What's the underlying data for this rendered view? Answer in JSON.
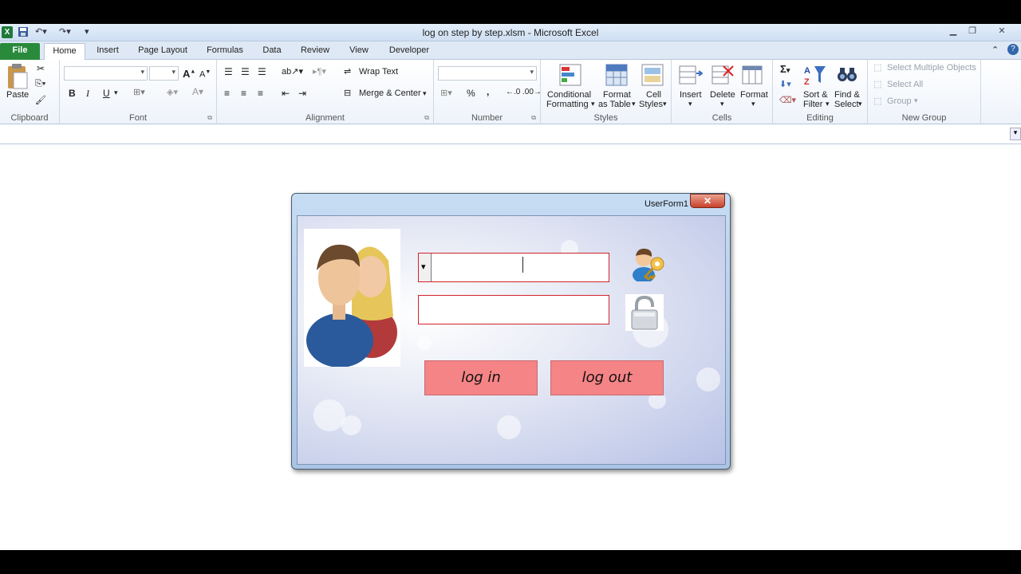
{
  "window": {
    "title": "log on step by step.xlsm  -  Microsoft Excel",
    "app_icon": "excel-icon",
    "controls": [
      "minimize-icon",
      "maximize-icon",
      "close-icon"
    ]
  },
  "tabs": [
    "File",
    "Home",
    "Insert",
    "Page Layout",
    "Formulas",
    "Data",
    "Review",
    "View",
    "Developer"
  ],
  "ribbon": {
    "clipboard": {
      "label": "Clipboard",
      "paste": "Paste"
    },
    "font": {
      "label": "Font",
      "bold": "B",
      "italic": "I",
      "underline": "U"
    },
    "alignment": {
      "label": "Alignment",
      "wrap_text": "Wrap Text",
      "merge_center": "Merge & Center"
    },
    "number": {
      "label": "Number",
      "percent": "%",
      "comma": ","
    },
    "styles": {
      "label": "Styles",
      "conditional_1": "Conditional",
      "conditional_2": "Formatting",
      "format_table_1": "Format",
      "format_table_2": "as Table",
      "cell_styles_1": "Cell",
      "cell_styles_2": "Styles"
    },
    "cells": {
      "label": "Cells",
      "insert": "Insert",
      "delete": "Delete",
      "format": "Format"
    },
    "editing": {
      "label": "Editing",
      "sort_1": "Sort &",
      "sort_2": "Filter",
      "find_1": "Find &",
      "find_2": "Select"
    },
    "new_group": {
      "label": "New Group",
      "select_multiple": "Select Multiple Objects",
      "select_all": "Select All",
      "group": "Group"
    }
  },
  "userform": {
    "title": "UserForm1",
    "close": "✕",
    "username_value": "",
    "password_value": "",
    "login_label": "log in",
    "logout_label": "log out"
  }
}
